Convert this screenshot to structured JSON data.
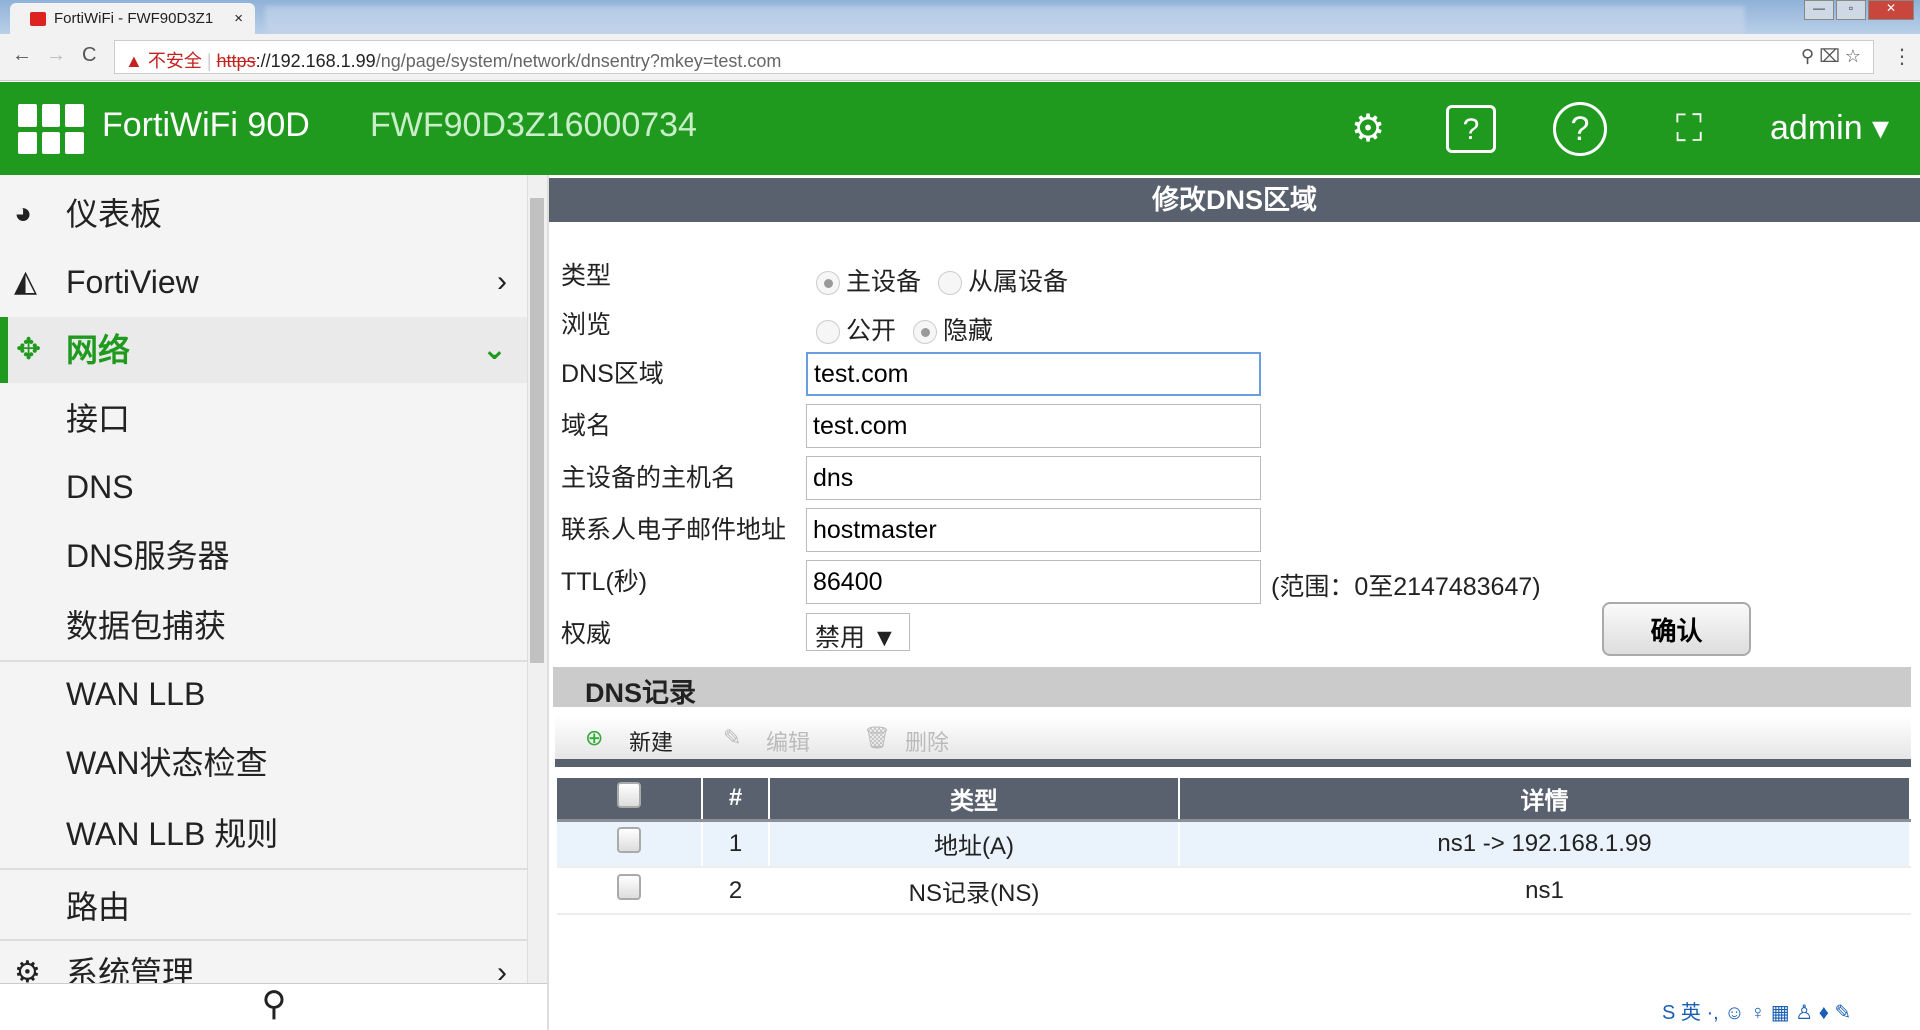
{
  "browser": {
    "tab_title": "FortiWiFi - FWF90D3Z1",
    "tab_close": "×",
    "back": "←",
    "forward": "→",
    "reload": "C",
    "security": "▲ 不安全",
    "url_scheme": "https",
    "url_host": "://192.168.1.99",
    "url_path": "/ng/page/system/network/dnsentry?mkey=test.com"
  },
  "header": {
    "product": "FortiWiFi 90D",
    "serial": "FWF90D3Z16000734",
    "user": "admin ▾",
    "icons": [
      "cli-console-icon",
      "video-icon",
      "help-icon",
      "fullscreen-icon"
    ]
  },
  "sidebar": {
    "items": [
      {
        "label": "仪表板",
        "icon": "dashboard-icon"
      },
      {
        "label": "FortiView",
        "icon": "chart-icon",
        "chevron": "›"
      },
      {
        "label": "网络",
        "icon": "move-icon",
        "chevron": "⌄"
      },
      {
        "label": "接口"
      },
      {
        "label": "DNS"
      },
      {
        "label": "DNS服务器"
      },
      {
        "label": "数据包捕获"
      },
      {
        "label": "WAN LLB"
      },
      {
        "label": "WAN状态检查"
      },
      {
        "label": "WAN LLB 规则"
      },
      {
        "label": "路由"
      },
      {
        "label": "系统管理",
        "icon": "gear-icon",
        "chevron": "›"
      }
    ],
    "search_icon": "⚲"
  },
  "form": {
    "title": "修改DNS区域",
    "type_label": "类型",
    "type_options": [
      "主设备",
      "从属设备"
    ],
    "type_selected": "主设备",
    "view_label": "浏览",
    "view_options": [
      "公开",
      "隐藏"
    ],
    "view_selected": "隐藏",
    "zone_label": "DNS区域",
    "zone_value": "test.com",
    "domain_label": "域名",
    "domain_value": "test.com",
    "host_label": "主设备的主机名",
    "host_value": "dns",
    "email_label": "联系人电子邮件地址",
    "email_value": "hostmaster",
    "ttl_label": "TTL(秒)",
    "ttl_value": "86400",
    "ttl_range": "(范围：0至2147483647)",
    "auth_label": "权威",
    "auth_value": "禁用 ▼",
    "ok": "确认"
  },
  "records": {
    "title": "DNS记录",
    "new": "新建",
    "edit": "编辑",
    "delete": "删除",
    "columns": [
      "#",
      "类型",
      "详情"
    ],
    "rows": [
      {
        "id": "1",
        "type": "地址(A)",
        "detail": "ns1 -> 192.168.1.99"
      },
      {
        "id": "2",
        "type": "NS记录(NS)",
        "detail": "ns1"
      }
    ]
  },
  "ime": "S 英 ·, ☺ ♀ ▦ ♙ ♦ ✎"
}
